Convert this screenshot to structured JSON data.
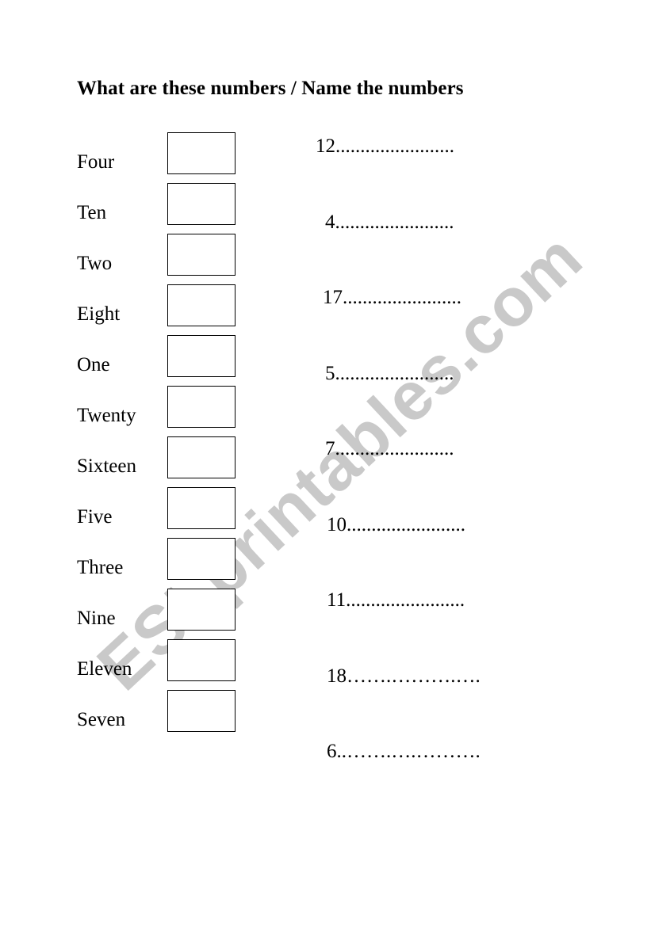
{
  "page": {
    "title": "What are these numbers / Name the numbers",
    "background_color": "#ffffff",
    "text_color": "#000000"
  },
  "watermark": {
    "text": "ESLprintables.com",
    "color": "#c9c9c9"
  },
  "left_column": {
    "items": [
      {
        "word": "Four",
        "box": ""
      },
      {
        "word": "Ten",
        "box": ""
      },
      {
        "word": "Two",
        "box": ""
      },
      {
        "word": "Eight",
        "box": ""
      },
      {
        "word": "One",
        "box": ""
      },
      {
        "word": "Twenty",
        "box": ""
      },
      {
        "word": "Sixteen",
        "box": ""
      },
      {
        "word": "Five",
        "box": ""
      },
      {
        "word": "Three",
        "box": ""
      },
      {
        "word": "Nine",
        "box": ""
      },
      {
        "word": "Eleven",
        "box": ""
      },
      {
        "word": "Seven",
        "box": ""
      }
    ]
  },
  "right_column": {
    "items": [
      {
        "number": "12",
        "dots": " ........................",
        "indent": 0
      },
      {
        "number": "4",
        "dots": "........................",
        "indent": 12
      },
      {
        "number": "17",
        "dots": "........................",
        "indent": 9
      },
      {
        "number": "5",
        "dots": "........................",
        "indent": 12
      },
      {
        "number": "7",
        "dots": "........................",
        "indent": 12
      },
      {
        "number": "10",
        "dots": "........................",
        "indent": 14
      },
      {
        "number": "11",
        "dots": "........................",
        "indent": 14
      },
      {
        "number": "18",
        "dots": "…….……….….",
        "indent": 14
      },
      {
        "number": "6",
        "dots": "..…….….……….",
        "indent": 14
      }
    ]
  }
}
